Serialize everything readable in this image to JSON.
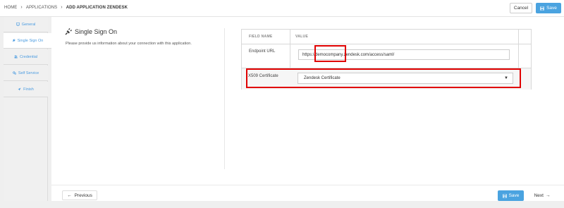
{
  "breadcrumb": {
    "items": [
      "HOME",
      "APPLICATIONS",
      "ADD APPLICATION ZENDESK"
    ],
    "separator": "›"
  },
  "header": {
    "cancel_label": "Cancel",
    "save_label": "Save"
  },
  "sidebar": {
    "steps": [
      {
        "label": "General",
        "icon": "monitor-icon",
        "active": false
      },
      {
        "label": "Single Sign On",
        "icon": "plug-icon",
        "active": true
      },
      {
        "label": "Credential",
        "icon": "users-icon",
        "active": false
      },
      {
        "label": "Self Service",
        "icon": "gears-icon",
        "active": false
      },
      {
        "label": "Finish",
        "icon": "paper-plane-icon",
        "active": false
      }
    ]
  },
  "section": {
    "title": "Single Sign On",
    "description": "Please provide us information about your connection with this application."
  },
  "table": {
    "headers": [
      "FIELD NAME",
      "VALUE"
    ],
    "rows": [
      {
        "label": "Endpoint URL",
        "value": "https://democompany.zendesk.com/access/saml/"
      },
      {
        "label": "X509 Certificate",
        "value": "Zendesk Certificate"
      }
    ]
  },
  "footer": {
    "previous_label": "Previous",
    "save_label": "Save",
    "next_label": "Next"
  },
  "colors": {
    "accent": "#4aa3e0",
    "highlight": "#e00000"
  }
}
